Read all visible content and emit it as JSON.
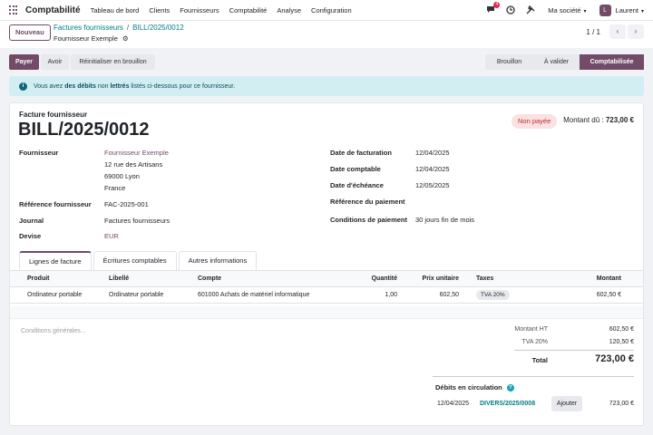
{
  "navbar": {
    "app_name": "Comptabilité",
    "menu": [
      "Tableau de bord",
      "Clients",
      "Fournisseurs",
      "Comptabilité",
      "Analyse",
      "Configuration"
    ],
    "chat_badge": "4",
    "company": "Ma société",
    "user_initial": "L",
    "user_name": "Laurent",
    "icons": [
      "apps-grid-icon",
      "chat-icon",
      "clock-icon",
      "tools-icon",
      "chevron-down-icon"
    ]
  },
  "control_panel": {
    "new_button": "Nouveau",
    "breadcrumb_parent": "Factures fournisseurs",
    "breadcrumb_separator": "/",
    "breadcrumb_current": "BILL/2025/0012",
    "sub_title": "Fournisseur Exemple",
    "pager_value": "1 / 1"
  },
  "statusbar": {
    "buttons": [
      "Payer",
      "Avoir",
      "Réinitialiser en brouillon"
    ],
    "stages": [
      "Brouillon",
      "À valider",
      "Comptabilisée"
    ],
    "active_stage": "Comptabilisée"
  },
  "alert": {
    "text_before": "Vous avez ",
    "text_bold": "des débits",
    "text_middle": " non ",
    "text_bold2": "lettrés",
    "text_after": " listés ci-dessous pour ce fournisseur."
  },
  "document": {
    "label": "Facture fournisseur",
    "name": "BILL/2025/0012",
    "payment_state": "Non payée",
    "amount_due_label": "Montant dû :",
    "amount_due_value": "723,00 €"
  },
  "left_fields": {
    "vendor_label": "Fournisseur",
    "vendor_name": "Fournisseur Exemple",
    "vendor_street": "12 rue des Artisans",
    "vendor_city": "69000 Lyon",
    "vendor_country": "France",
    "ref_label": "Référence fournisseur",
    "ref_value": "FAC-2025-001",
    "journal_label": "Journal",
    "journal_value": "Factures fournisseurs",
    "currency_label": "Devise",
    "currency_value": "EUR"
  },
  "right_fields": {
    "invoice_date_label": "Date de facturation",
    "invoice_date_value": "12/04/2025",
    "accounting_date_label": "Date comptable",
    "accounting_date_value": "12/04/2025",
    "due_date_label": "Date d'échéance",
    "due_date_value": "12/05/2025",
    "payment_ref_label": "Référence du paiement",
    "payment_ref_value": "",
    "payment_terms_label": "Conditions de paiement",
    "payment_terms_value": "30 jours fin de mois"
  },
  "tabs": [
    "Lignes de facture",
    "Écritures comptables",
    "Autres informations"
  ],
  "lines": {
    "headers": [
      "Produit",
      "Libellé",
      "Compte",
      "Quantité",
      "Prix unitaire",
      "Taxes",
      "Montant"
    ],
    "rows": [
      {
        "product": "Ordinateur portable",
        "label": "Ordinateur portable",
        "account": "601000 Achats de matériel informatique",
        "quantity": "1,00",
        "unit_price": "602,50",
        "taxes": "TVA 20%",
        "amount": "602,50 €"
      }
    ]
  },
  "footer": {
    "conditions_placeholder": "Conditions générales...",
    "untaxed_label": "Montant HT",
    "untaxed_value": "602,50 €",
    "tax_label": "TVA 20%",
    "tax_value": "120,50 €",
    "total_label": "Total",
    "total_value": "723,00 €",
    "outstanding_title": "Débits en circulation",
    "outstanding_date": "12/04/2025",
    "outstanding_ref": "DIVERS/2025/0008",
    "outstanding_add": "Ajouter",
    "outstanding_amount": "723,00 €"
  },
  "colors": {
    "brand": "#714b67",
    "link": "#017e84",
    "alert_bg": "#d3eef3",
    "unpaid_badge": "#c42a2a"
  }
}
